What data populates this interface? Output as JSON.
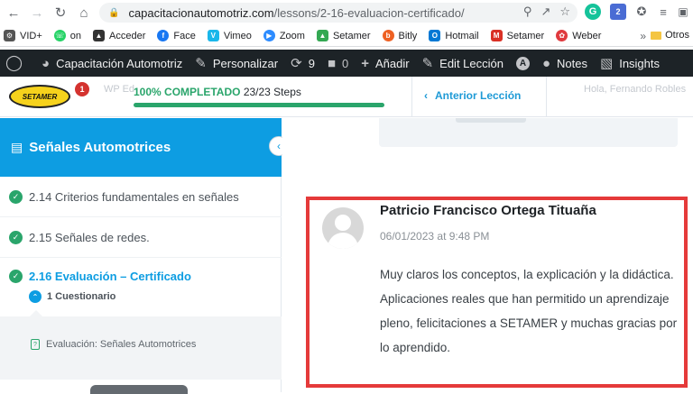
{
  "browser": {
    "url_domain": "capacitacionautomotriz.com",
    "url_path": "/lessons/2-16-evaluacion-certificado/",
    "ext_badge": "2"
  },
  "bookmarks": {
    "items": [
      {
        "label": "VID+",
        "color": "#555555"
      },
      {
        "label": "on",
        "color": "#25d366"
      },
      {
        "label": "Acceder",
        "color": "#333333"
      },
      {
        "label": "Face",
        "color": "#1877f2"
      },
      {
        "label": "Vimeo",
        "color": "#1ab7ea"
      },
      {
        "label": "Zoom",
        "color": "#2d8cff"
      },
      {
        "label": "Setamer",
        "color": "#34a853"
      },
      {
        "label": "Bitly",
        "color": "#ee6123"
      },
      {
        "label": "Hotmail",
        "color": "#0078d4"
      },
      {
        "label": "Setamer",
        "color": "#d93025"
      },
      {
        "label": "Weber",
        "color": "#e03a3e"
      }
    ],
    "more": "»",
    "other": "Otros"
  },
  "wpbar": {
    "site": "Capacitación Automotriz",
    "customize": "Personalizar",
    "updates": "9",
    "comments": "0",
    "add": "Añadir",
    "edit": "Edit Lección",
    "notes": "Notes",
    "insights": "Insights"
  },
  "course_header": {
    "logo_text": "SETAMER",
    "notif_count": "1",
    "ghost_left": "WP Ed",
    "ghost_right": "Hola, Fernando Robles",
    "progress_pct": "100% COMPLETADO",
    "progress_steps": "23/23 Steps",
    "progress_value": 100,
    "prev_lesson": "Anterior Lección"
  },
  "sidebar": {
    "title": "Señales Automotrices",
    "lessons": [
      {
        "label": "2.14 Criterios fundamentales en señales"
      },
      {
        "label": "2.15 Señales de redes."
      },
      {
        "label": "2.16 Evaluación – Certificado"
      }
    ],
    "quiz_toggle": "1 Cuestionario",
    "quiz_item": "Evaluación: Señales Automotrices"
  },
  "comment": {
    "author": "Patricio Francisco Ortega Tituaña",
    "date": "06/01/2023 at 9:48 PM",
    "text": "Muy claros los conceptos, la explicación y la didáctica. Aplicaciones reales que han permitido un aprendizaje pleno, felicitaciones a SETAMER y muchas gracias por lo aprendido."
  },
  "colors": {
    "accent": "#0d9de2",
    "success": "#2aa56b",
    "highlight": "#e53a3a",
    "wpbar": "#1d2327"
  }
}
